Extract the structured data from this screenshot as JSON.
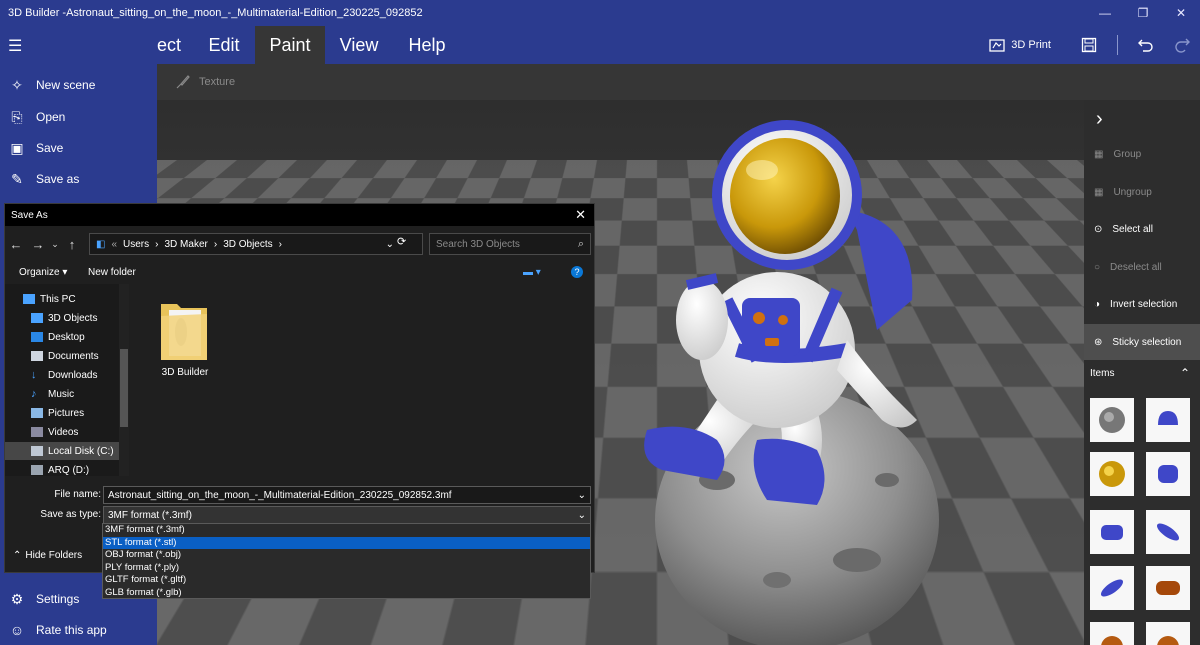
{
  "window": {
    "title": "3D Builder -Astronaut_sitting_on_the_moon_-_Multimaterial-Edition_230225_092852",
    "controls": [
      "minimize",
      "maximize",
      "close"
    ]
  },
  "ribbon": {
    "tabs": [
      {
        "label": "ect",
        "active": false
      },
      {
        "label": "Edit",
        "active": false
      },
      {
        "label": "Paint",
        "active": true
      },
      {
        "label": "View",
        "active": false
      },
      {
        "label": "Help",
        "active": false
      }
    ],
    "print_label": "3D Print"
  },
  "toolbar": {
    "texture_label": "Texture"
  },
  "app_menu": {
    "items": [
      {
        "label": "New scene",
        "icon": "new-scene-icon"
      },
      {
        "label": "Open",
        "icon": "open-icon"
      },
      {
        "label": "Save",
        "icon": "save-icon"
      },
      {
        "label": "Save as",
        "icon": "save-as-icon"
      }
    ],
    "bottom_items": [
      {
        "label": "Settings",
        "icon": "gear-icon"
      },
      {
        "label": "Rate this app",
        "icon": "smiley-icon"
      }
    ]
  },
  "right_panel": {
    "actions": [
      {
        "label": "Group",
        "enabled": false
      },
      {
        "label": "Ungroup",
        "enabled": false
      },
      {
        "label": "Select all",
        "enabled": true
      },
      {
        "label": "Deselect all",
        "enabled": false
      },
      {
        "label": "Invert selection",
        "enabled": true
      },
      {
        "label": "Sticky selection",
        "enabled": true,
        "highlighted": true
      }
    ],
    "items_header": "Items"
  },
  "dialog": {
    "title": "Save As",
    "breadcrumb": [
      "Users",
      "3D Maker",
      "3D Objects"
    ],
    "search_placeholder": "Search 3D Objects",
    "organize_label": "Organize",
    "new_folder_label": "New folder",
    "nav_items": [
      {
        "label": "This PC",
        "icon": "pc-icon"
      },
      {
        "label": "3D Objects",
        "icon": "cube-icon"
      },
      {
        "label": "Desktop",
        "icon": "desktop-icon"
      },
      {
        "label": "Documents",
        "icon": "documents-icon"
      },
      {
        "label": "Downloads",
        "icon": "download-icon"
      },
      {
        "label": "Music",
        "icon": "music-icon"
      },
      {
        "label": "Pictures",
        "icon": "pictures-icon"
      },
      {
        "label": "Videos",
        "icon": "videos-icon"
      },
      {
        "label": "Local Disk (C:)",
        "icon": "disk-icon",
        "selected": true
      },
      {
        "label": "ARQ (D:)",
        "icon": "drive-icon"
      }
    ],
    "folder_item": "3D Builder",
    "file_name_label": "File name:",
    "file_name_value": "Astronaut_sitting_on_the_moon_-_Multimaterial-Edition_230225_092852.3mf",
    "save_type_label": "Save as type:",
    "save_type_value": "3MF format (*.3mf)",
    "hide_folders_label": "Hide Folders",
    "type_options": [
      {
        "label": "3MF format (*.3mf)",
        "selected": false
      },
      {
        "label": "STL format (*.stl)",
        "selected": true
      },
      {
        "label": "OBJ format (*.obj)",
        "selected": false
      },
      {
        "label": "PLY format (*.ply)",
        "selected": false
      },
      {
        "label": "GLTF format (*.gltf)",
        "selected": false
      },
      {
        "label": "GLB format (*.glb)",
        "selected": false
      }
    ]
  },
  "colors": {
    "brand_blue": "#2b3b8f",
    "selection_blue": "#0a5fc4",
    "astronaut_accent": "#3f47c8",
    "visor_gold": "#d4a20a"
  }
}
